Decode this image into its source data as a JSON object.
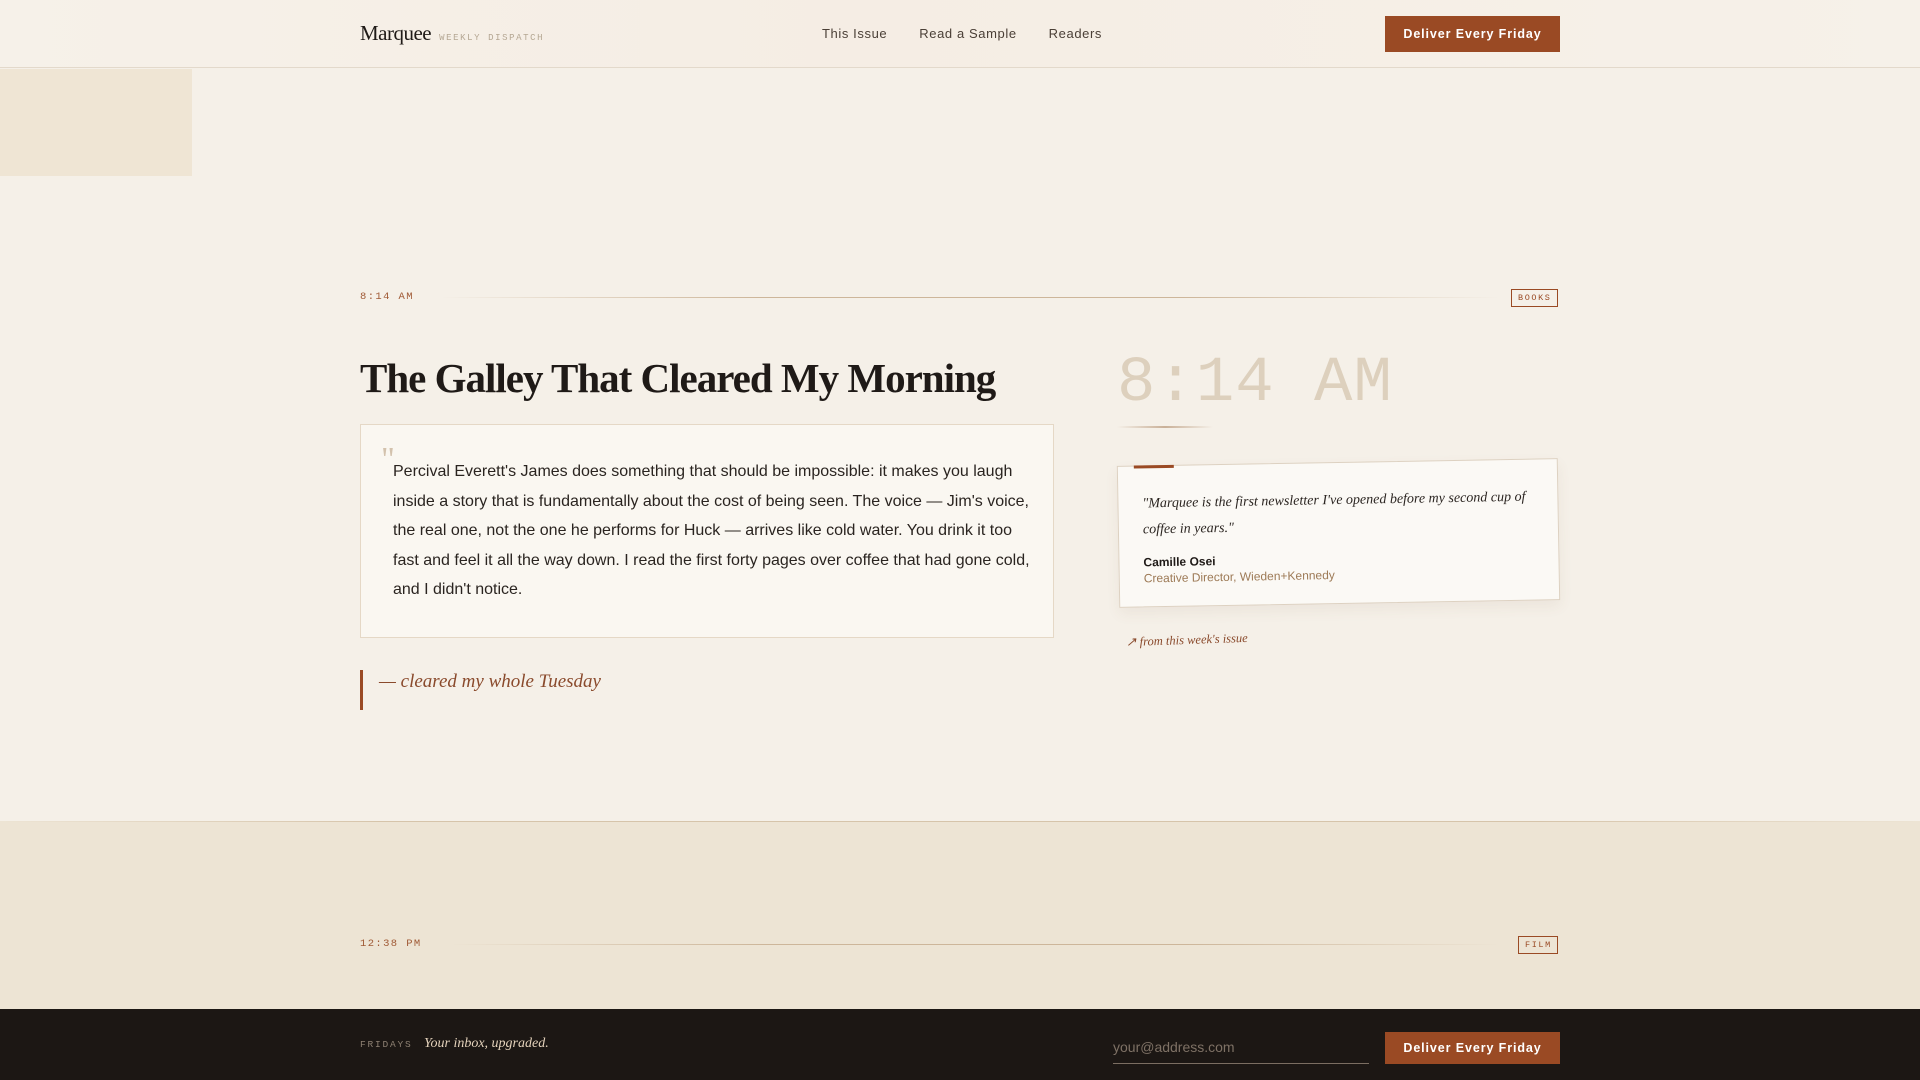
{
  "header": {
    "brand": "Marquee",
    "tagline": "WEEKLY DISPATCH",
    "nav": [
      "This Issue",
      "Read a Sample",
      "Readers"
    ],
    "cta": "Deliver Every Friday"
  },
  "entry": {
    "time": "8:14 AM",
    "category": "BOOKS",
    "headline": "The Galley That Cleared My Morning",
    "quote_mark": "\"",
    "excerpt": "Percival Everett's James does something that should be impossible: it makes you laugh inside a story that is fundamentally about the cost of being seen. The voice — Jim's voice, the real one, not the one he performs for Huck — arrives like cold water. You drink it too fast and feel it all the way down. I read the first forty pages over coffee that had gone cold, and I didn't notice.",
    "pull_quote": "— cleared my whole Tuesday",
    "big_time": "8:14 AM",
    "testimonial": {
      "quote": "\"Marquee is the first newsletter I've opened before my second cup of coffee in years.\"",
      "name": "Camille Osei",
      "role": "Creative Director, Wieden+Kennedy"
    },
    "annotation": "↗ from this week's issue"
  },
  "next_entry": {
    "time": "12:38 PM",
    "category": "FILM"
  },
  "footer": {
    "label": "FRIDAYS",
    "tagline": "Your inbox, upgraded.",
    "email_placeholder": "your@address.com",
    "cta": "Deliver Every Friday"
  },
  "colors": {
    "accent": "#9a4a24",
    "background": "#f5f0e8",
    "footer_bg": "#1c1714"
  }
}
